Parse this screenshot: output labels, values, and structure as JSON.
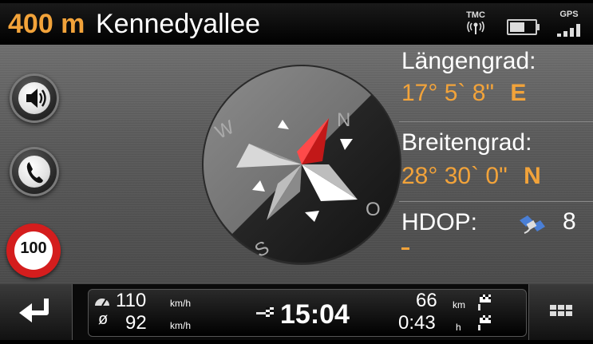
{
  "header": {
    "distance": "400 m",
    "street": "Kennedyallee",
    "tmc_label": "TMC",
    "gps_label": "GPS"
  },
  "left_controls": {
    "speed_limit": "100",
    "icons": [
      "speaker-icon",
      "phone-icon"
    ]
  },
  "compass": {
    "labels": {
      "north": "N",
      "west": "W",
      "south": "S",
      "east": "O"
    }
  },
  "info": {
    "longitude_label": "Längengrad:",
    "longitude_value": "17° 5` 8\"",
    "longitude_dir": "E",
    "latitude_label": "Breitengrad:",
    "latitude_value": "28° 30` 0\"",
    "latitude_dir": "N",
    "hdop_label": "HDOP:",
    "hdop_value": "8"
  },
  "trip": {
    "speed_current": "110",
    "speed_avg": "92",
    "speed_unit": "km/h",
    "avg_symbol": "ø",
    "arrival_time": "15:04",
    "remaining_distance": "66",
    "distance_unit": "km",
    "remaining_time": "0:43",
    "time_unit": "h"
  },
  "colors": {
    "accent_orange": "#f2a33a",
    "speed_red": "#d41d1d",
    "compass_red": "#c21818"
  }
}
